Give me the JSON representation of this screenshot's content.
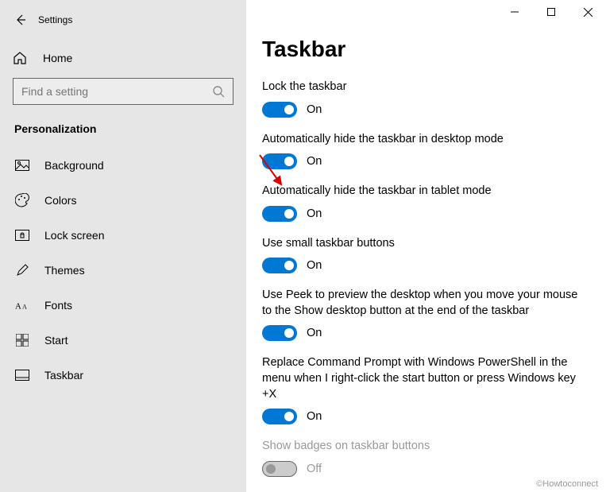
{
  "window": {
    "title": "Settings",
    "controls": {
      "minimize": "minimize",
      "maximize": "maximize",
      "close": "close"
    }
  },
  "sidebar": {
    "home_label": "Home",
    "search_placeholder": "Find a setting",
    "section_label": "Personalization",
    "items": [
      {
        "icon": "picture-icon",
        "label": "Background"
      },
      {
        "icon": "palette-icon",
        "label": "Colors"
      },
      {
        "icon": "lock-icon",
        "label": "Lock screen"
      },
      {
        "icon": "brush-icon",
        "label": "Themes"
      },
      {
        "icon": "font-icon",
        "label": "Fonts"
      },
      {
        "icon": "start-icon",
        "label": "Start"
      },
      {
        "icon": "taskbar-icon",
        "label": "Taskbar"
      }
    ]
  },
  "page": {
    "title": "Taskbar",
    "settings": [
      {
        "label": "Lock the taskbar",
        "state": "On",
        "enabled": true,
        "on": true
      },
      {
        "label": "Automatically hide the taskbar in desktop mode",
        "state": "On",
        "enabled": true,
        "on": true
      },
      {
        "label": "Automatically hide the taskbar in tablet mode",
        "state": "On",
        "enabled": true,
        "on": true
      },
      {
        "label": "Use small taskbar buttons",
        "state": "On",
        "enabled": true,
        "on": true
      },
      {
        "label": "Use Peek to preview the desktop when you move your mouse to the Show desktop button at the end of the taskbar",
        "state": "On",
        "enabled": true,
        "on": true
      },
      {
        "label": "Replace Command Prompt with Windows PowerShell in the menu when I right-click the start button or press Windows key +X",
        "state": "On",
        "enabled": true,
        "on": true
      },
      {
        "label": "Show badges on taskbar buttons",
        "state": "Off",
        "enabled": false,
        "on": false
      }
    ]
  },
  "watermark": "©Howtoconnect"
}
